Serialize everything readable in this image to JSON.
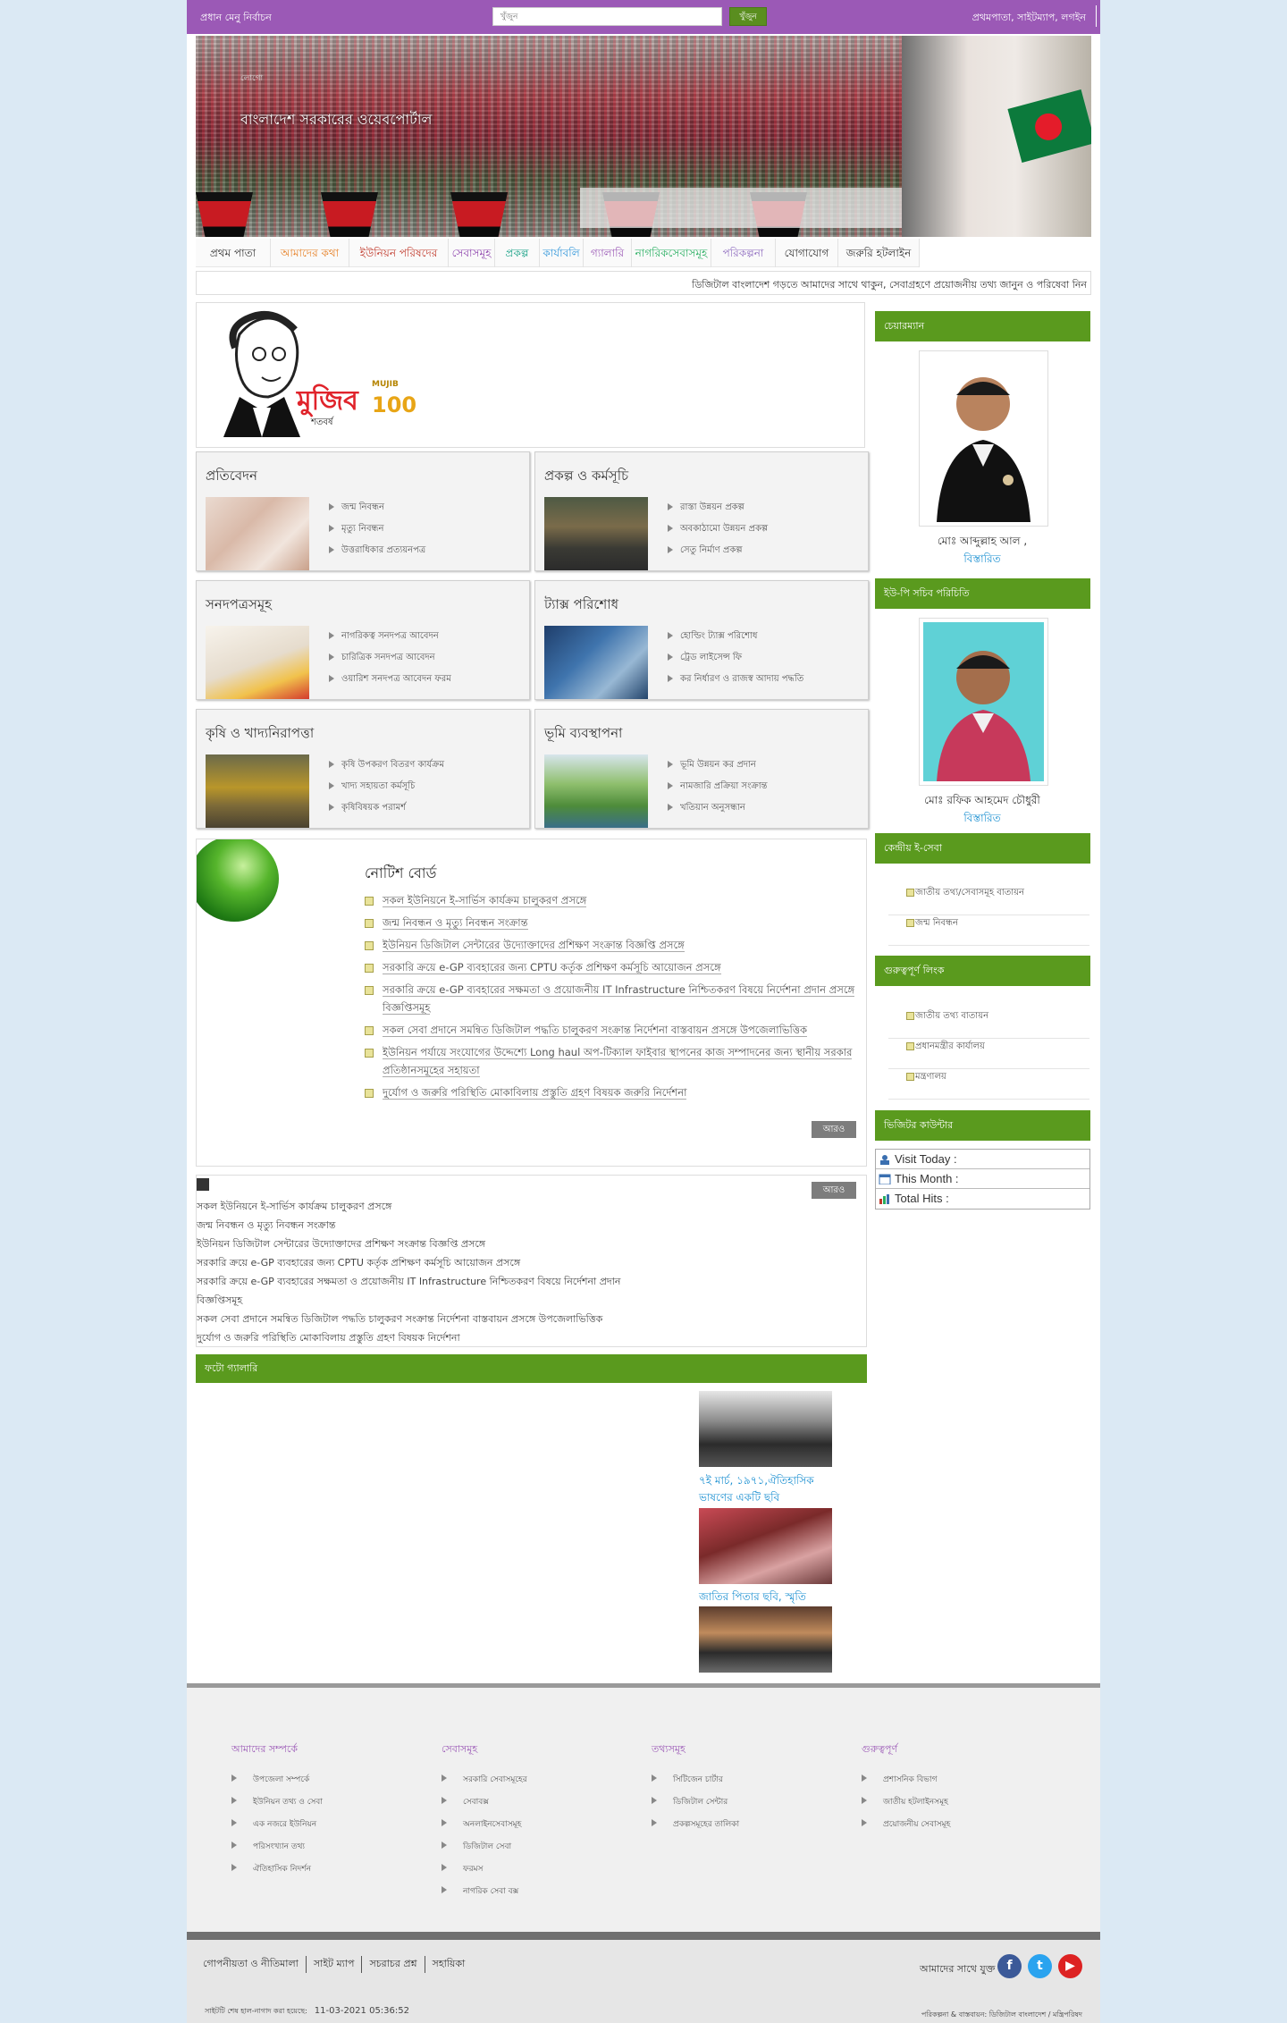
{
  "topbar": {
    "site_name": "প্রধান মেনু নির্বাচন",
    "search_placeholder": "খুঁজুন",
    "search_button": "খুঁজুন",
    "right_links": "প্রথমপাতা, সাইটম্যাপ, লগইন"
  },
  "banner": {
    "overlay_text": "বাংলাদেশ সরকারের ওয়েবপোর্টাল",
    "broken_image_alt": "লোগো"
  },
  "nav": {
    "items": [
      {
        "label": "প্রথম পাতা",
        "color": "#333333"
      },
      {
        "label": "আমাদের কথা",
        "color": "#e67e22"
      },
      {
        "label": "ইউনিয়ন পরিষদের",
        "color": "#c0392b"
      },
      {
        "label": "সেবাসমূহ",
        "color": "#8e44ad"
      },
      {
        "label": "প্রকল্প",
        "color": "#16a085"
      },
      {
        "label": "কার্যাবলি",
        "color": "#3498db"
      },
      {
        "label": "গ্যালারি",
        "color": "#9b59b6"
      },
      {
        "label": "নাগরিকসেবাসমূহ",
        "color": "#27ae60"
      },
      {
        "label": "পরিকল্পনা",
        "color": "#8e6bbf"
      },
      {
        "label": "যোগাযোগ",
        "color": "#333333"
      },
      {
        "label": "জরুরি হটলাইন",
        "color": "#333333"
      }
    ]
  },
  "ticker": {
    "text": "ডিজিটাল বাংলাদেশ গড়তে আমাদের সাথে থাকুন, সেবাগ্রহণে প্রয়োজনীয় তথ্য জানুন ও পরিষেবা নিন"
  },
  "mujib": {
    "word": "মুজিব",
    "sub": "শতবর্ষ",
    "label": "MUJIB",
    "number": "100"
  },
  "services": [
    {
      "title": "প্রতিবেদন",
      "items": [
        "জন্ম নিবন্ধন",
        "মৃত্যু নিবন্ধন",
        "উত্তরাধিকার প্রত্যয়নপত্র"
      ]
    },
    {
      "title": "প্রকল্প ও কর্মসূচি",
      "items": [
        "রাস্তা উন্নয়ন প্রকল্প",
        "অবকাঠামো উন্নয়ন প্রকল্প",
        "সেতু নির্মাণ প্রকল্প"
      ]
    },
    {
      "title": "সনদপত্রসমূহ",
      "items": [
        "নাগরিকত্ব সনদপত্র আবেদন",
        "চারিত্রিক সনদপত্র আবেদন",
        "ওয়ারিশ সনদপত্র আবেদন ফরম"
      ]
    },
    {
      "title": "ট্যাক্স পরিশোধ",
      "items": [
        "হোল্ডিং ট্যাক্স পরিশোধ",
        "ট্রেড লাইসেন্স ফি",
        "কর নির্ধারণ ও রাজস্ব আদায় পদ্ধতি"
      ]
    },
    {
      "title": "কৃষি ও খাদ্যনিরাপত্তা",
      "items": [
        "কৃষি উপকরণ বিতরণ কার্যক্রম",
        "খাদ্য সহায়তা কর্মসূচি",
        "কৃষিবিষয়ক পরামর্শ"
      ]
    },
    {
      "title": "ভূমি ব্যবস্থাপনা",
      "items": [
        "ভূমি উন্নয়ন কর প্রদান",
        "নামজারি প্রক্রিয়া সংক্রান্ত",
        "খতিয়ান অনুসন্ধান"
      ]
    }
  ],
  "notice_board": {
    "title": "নোটিশ বোর্ড",
    "items": [
      "সকল ইউনিয়নে ই-সার্ভিস কার্যক্রম চালুকরণ প্রসঙ্গে",
      "জন্ম নিবন্ধন ও মৃত্যু নিবন্ধন সংক্রান্ত",
      "ইউনিয়ন ডিজিটাল সেন্টারের উদ্যোক্তাদের প্রশিক্ষণ সংক্রান্ত বিজ্ঞপ্তি প্রসঙ্গে",
      "সরকারি ক্রয়ে e-GP ব্যবহারের জন্য CPTU কর্তৃক প্রশিক্ষণ কর্মসূচি আয়োজন প্রসঙ্গে",
      "সরকারি ক্রয়ে e-GP ব্যবহারের সক্ষমতা ও প্রয়োজনীয় IT Infrastructure নিশ্চিতকরণ বিষয়ে নির্দেশনা প্রদান প্রসঙ্গে বিজ্ঞপ্তিসমূহ",
      "সকল সেবা প্রদানে সমন্বিত ডিজিটাল পদ্ধতি চালুকরণ সংক্রান্ত নির্দেশনা বাস্তবায়ন প্রসঙ্গে উপজেলাভিত্তিক",
      "ইউনিয়ন পর্যায়ে সংযোগের উদ্দেশ্যে Long haul অপ-টিক্যাল ফাইবার স্থাপনের কাজ সম্পাদনের জন্য স্থানীয় সরকার প্রতিষ্ঠানসমূহের সহায়তা",
      "দুর্যোগ ও জরুরি পরিস্থিতি মোকাবিলায় প্রস্তুতি গ্রহণ বিষয়ক জরুরি নির্দেশনা"
    ],
    "more_label": "আরও"
  },
  "scroll_notices": {
    "more_label": "আরও",
    "items": [
      "সকল ইউনিয়নে ই-সার্ভিস কার্যক্রম চালুকরণ প্রসঙ্গে",
      "জন্ম নিবন্ধন ও মৃত্যু নিবন্ধন সংক্রান্ত",
      "ইউনিয়ন ডিজিটাল সেন্টারের উদ্যোক্তাদের প্রশিক্ষণ সংক্রান্ত বিজ্ঞপ্তি প্রসঙ্গে",
      "সরকারি ক্রয়ে e-GP ব্যবহারের জন্য CPTU কর্তৃক প্রশিক্ষণ কর্মসূচি আয়োজন প্রসঙ্গে",
      "সরকারি ক্রয়ে e-GP ব্যবহারের সক্ষমতা ও প্রয়োজনীয় IT Infrastructure নিশ্চিতকরণ বিষয়ে নির্দেশনা প্রদান",
      "বিজ্ঞপ্তিসমূহ",
      "সকল সেবা প্রদানে সমন্বিত ডিজিটাল পদ্ধতি চালুকরণ সংক্রান্ত নির্দেশনা বাস্তবায়ন প্রসঙ্গে উপজেলাভিত্তিক",
      "দুর্যোগ ও জরুরি পরিস্থিতি মোকাবিলায় প্রস্তুতি গ্রহণ বিষয়ক নির্দেশনা"
    ]
  },
  "gallery": {
    "title": "ফটো গ্যালারি",
    "captions": [
      "৭ই মার্চ, ১৯৭১,ঐতিহাসিক ভাষণের একটি ছবি",
      "জাতির পিতার ছবি, স্মৃতি"
    ]
  },
  "sidebar": {
    "chairman_title": "চেয়ারম্যান",
    "chairman_name": "মোঃ আব্দুল্লাহ আল ,",
    "chairman_link": "বিস্তারিত",
    "secretary_title": "ইউ-পি সচিব পরিচিতি",
    "secretary_name": "মোঃ রফিক আহমেদ চৌধুরী",
    "secretary_link": "বিস্তারিত",
    "eservice_title": "কেন্দ্রীয় ই-সেবা",
    "eservice_items": [
      "জাতীয় তথ্য/সেবাসমূহ বাতায়ন",
      "জন্ম নিবন্ধন"
    ],
    "important_title": "গুরুত্বপূর্ণ লিংক",
    "important_items": [
      "জাতীয় তথ্য বাতায়ন",
      "প্রধানমন্ত্রীর কার্যালয়",
      "মন্ত্রণালয়"
    ],
    "visitor_title": "ভিজিটর কাউন্টার",
    "visitor_rows": [
      "Visit Today :",
      "This Month :",
      "Total Hits :"
    ]
  },
  "footer": {
    "columns": [
      {
        "title": "আমাদের সম্পর্কে",
        "items": [
          "উপজেলা সম্পর্কে",
          "ইউনিয়ন তথ্য ও সেবা",
          "এক নজরে ইউনিয়ন",
          "পরিসংখ্যান তথ্য",
          "ঐতিহাসিক নিদর্শন"
        ]
      },
      {
        "title": "সেবাসমূহ",
        "items": [
          "সরকারি সেবাসমূহের",
          "সেবাবক্স",
          "অনলাইনসেবাসমূহ",
          "ডিজিটাল সেবা",
          "ফরমস",
          "নাগরিক সেবা বক্স"
        ]
      },
      {
        "title": "তথ্যসমূহ",
        "items": [
          "সিটিজেন চার্টার",
          "ডিজিটাল সেন্টার",
          "প্রকল্পসমূহের তালিকা"
        ]
      },
      {
        "title": "গুরুত্বপূর্ণ",
        "items": [
          "প্রশাসনিক বিভাগ",
          "জাতীয় হটলাইনসমূহ",
          "প্রয়োজনীয় সেবাসমূহ"
        ]
      }
    ],
    "bottom_links": [
      "গোপনীয়তা ও নীতিমালা",
      "সাইট ম্যাপ",
      "সচরাচর প্রশ্ন",
      "সহায়িকা"
    ],
    "social_label": "আমাদের সাথে যুক্ত",
    "updated_label": "সাইটটি শেষ হাল-নাগাদ করা হয়েছে:",
    "updated_value": "11-03-2021 05:36:52",
    "credit": "পরিকল্পনা & বাস্তবায়ন: ডিজিটাল বাংলাদেশ / মন্ত্রিপরিষদ"
  }
}
